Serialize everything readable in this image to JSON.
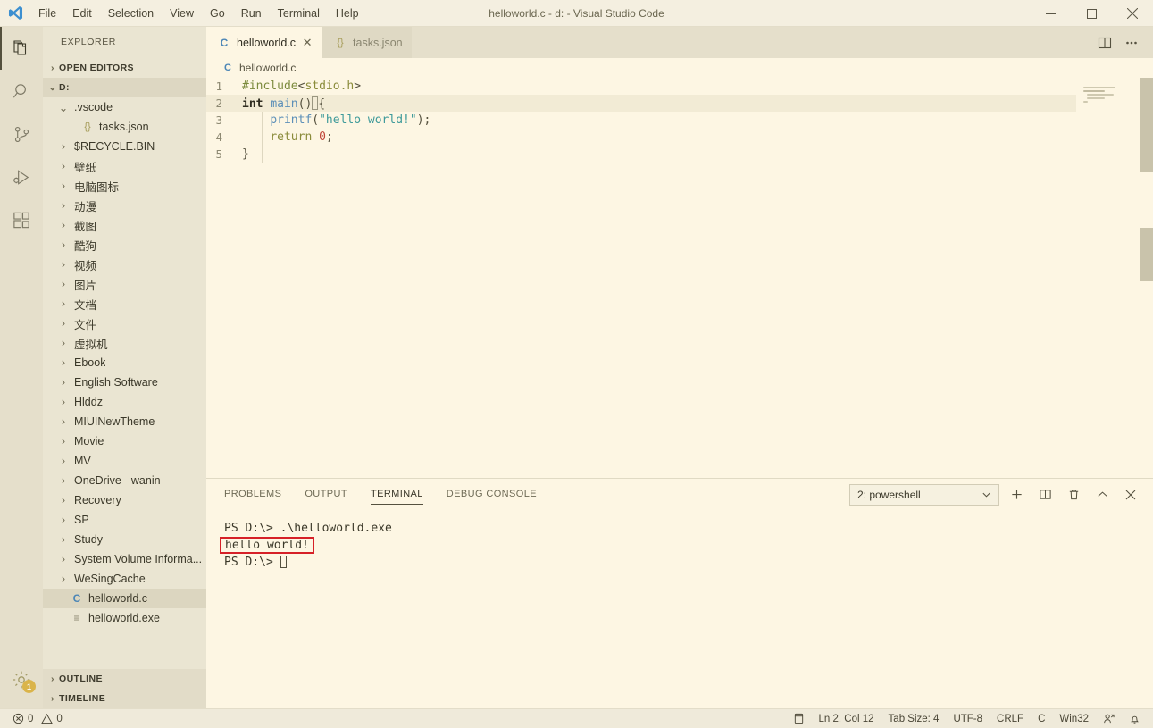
{
  "window": {
    "title": "helloworld.c - d: - Visual Studio Code",
    "logo_icon": "vscode-logo-icon",
    "minimize_label": "—",
    "maximize_label": "□",
    "close_label": "✕"
  },
  "menubar": {
    "items": [
      {
        "label": "File"
      },
      {
        "label": "Edit"
      },
      {
        "label": "Selection"
      },
      {
        "label": "View"
      },
      {
        "label": "Go"
      },
      {
        "label": "Run"
      },
      {
        "label": "Terminal"
      },
      {
        "label": "Help"
      }
    ]
  },
  "activitybar": {
    "items": [
      {
        "name": "explorer-icon",
        "label": "Explorer",
        "active": true
      },
      {
        "name": "search-icon",
        "label": "Search",
        "active": false
      },
      {
        "name": "source-control-icon",
        "label": "Source Control",
        "active": false
      },
      {
        "name": "run-and-debug-icon",
        "label": "Run and Debug",
        "active": false
      },
      {
        "name": "extensions-icon",
        "label": "Extensions",
        "active": false
      }
    ],
    "manage": {
      "name": "gear-icon",
      "label": "Manage",
      "badge": "1"
    }
  },
  "sidebar": {
    "title": "EXPLORER",
    "open_editors_label": "OPEN EDITORS",
    "root_label": "D:",
    "tree": [
      {
        "label": ".vscode",
        "type": "folder",
        "expanded": true,
        "indent": 1
      },
      {
        "label": "tasks.json",
        "type": "json",
        "indent": 2
      },
      {
        "label": "$RECYCLE.BIN",
        "type": "folder",
        "indent": 1
      },
      {
        "label": "壁纸",
        "type": "folder",
        "indent": 1
      },
      {
        "label": "电脑图标",
        "type": "folder",
        "indent": 1
      },
      {
        "label": "动漫",
        "type": "folder",
        "indent": 1
      },
      {
        "label": "截图",
        "type": "folder",
        "indent": 1
      },
      {
        "label": "酷狗",
        "type": "folder",
        "indent": 1
      },
      {
        "label": "视频",
        "type": "folder",
        "indent": 1
      },
      {
        "label": "图片",
        "type": "folder",
        "indent": 1
      },
      {
        "label": "文档",
        "type": "folder",
        "indent": 1
      },
      {
        "label": "文件",
        "type": "folder",
        "indent": 1
      },
      {
        "label": "虚拟机",
        "type": "folder",
        "indent": 1
      },
      {
        "label": "Ebook",
        "type": "folder",
        "indent": 1
      },
      {
        "label": "English Software",
        "type": "folder",
        "indent": 1
      },
      {
        "label": "Hlddz",
        "type": "folder",
        "indent": 1
      },
      {
        "label": "MIUINewTheme",
        "type": "folder",
        "indent": 1
      },
      {
        "label": "Movie",
        "type": "folder",
        "indent": 1
      },
      {
        "label": "MV",
        "type": "folder",
        "indent": 1
      },
      {
        "label": "OneDrive - wanin",
        "type": "folder",
        "indent": 1
      },
      {
        "label": "Recovery",
        "type": "folder",
        "indent": 1
      },
      {
        "label": "SP",
        "type": "folder",
        "indent": 1
      },
      {
        "label": "Study",
        "type": "folder",
        "indent": 1
      },
      {
        "label": "System Volume Informa...",
        "type": "folder",
        "indent": 1
      },
      {
        "label": "WeSingCache",
        "type": "folder",
        "indent": 1
      },
      {
        "label": "helloworld.c",
        "type": "c",
        "indent": 1,
        "selected": true
      },
      {
        "label": "helloworld.exe",
        "type": "exe",
        "indent": 1
      }
    ],
    "bottom_sections": [
      {
        "label": "OUTLINE"
      },
      {
        "label": "TIMELINE"
      }
    ]
  },
  "editor": {
    "tabs": [
      {
        "label": "helloworld.c",
        "icon": "c-file-icon",
        "active": true,
        "closable": true
      },
      {
        "label": "tasks.json",
        "icon": "json-file-icon",
        "active": false,
        "closable": false
      }
    ],
    "tab_actions": [
      {
        "name": "split-editor-icon",
        "label": "Split Editor"
      },
      {
        "name": "more-actions-icon",
        "label": "More Actions..."
      }
    ],
    "breadcrumb": {
      "icon": "c-file-icon",
      "label": "helloworld.c"
    },
    "lines": [
      {
        "num": "1",
        "text": "#include<stdio.h>"
      },
      {
        "num": "2",
        "text": "int main(){",
        "current": true
      },
      {
        "num": "3",
        "text": "    printf(\"hello world!\");"
      },
      {
        "num": "4",
        "text": "    return 0;"
      },
      {
        "num": "5",
        "text": "}"
      }
    ]
  },
  "panel": {
    "tabs": [
      {
        "label": "PROBLEMS",
        "active": false
      },
      {
        "label": "OUTPUT",
        "active": false
      },
      {
        "label": "TERMINAL",
        "active": true
      },
      {
        "label": "DEBUG CONSOLE",
        "active": false
      }
    ],
    "terminal_select": {
      "value": "2: powershell",
      "chevron": "chevron-down-icon"
    },
    "actions": [
      {
        "name": "new-terminal-icon",
        "label": "+"
      },
      {
        "name": "split-terminal-icon",
        "label": "Split Terminal"
      },
      {
        "name": "kill-terminal-icon",
        "label": "Kill Terminal"
      },
      {
        "name": "maximize-panel-icon",
        "label": "Maximize Panel Size"
      },
      {
        "name": "close-panel-icon",
        "label": "Close Panel"
      }
    ],
    "terminal": {
      "prompt1": "PS D:\\> ",
      "command1": ".\\helloworld.exe",
      "output": "hello world!",
      "prompt2": "PS D:\\> ",
      "highlight_color": "#D62027"
    }
  },
  "statusbar": {
    "left": [
      {
        "name": "errors-warnings",
        "icon": "error-icon",
        "errors": "0",
        "warn_icon": "warning-icon",
        "warnings": "0"
      }
    ],
    "right": [
      {
        "name": "layout-icon",
        "label": ""
      },
      {
        "name": "cursor-position",
        "label": "Ln 2, Col 12"
      },
      {
        "name": "indentation",
        "label": "Tab Size: 4"
      },
      {
        "name": "encoding",
        "label": "UTF-8"
      },
      {
        "name": "eol",
        "label": "CRLF"
      },
      {
        "name": "language-mode",
        "label": "C"
      },
      {
        "name": "platform",
        "label": "Win32"
      },
      {
        "name": "remote-icon",
        "label": ""
      },
      {
        "name": "notifications-bell-icon",
        "label": ""
      }
    ]
  },
  "colors": {
    "editor_bg": "#FDF6E3",
    "sidebar_bg": "#EAE5D2",
    "titlebar_bg": "#F4EFE0",
    "accent_red": "#D62027",
    "badge_gold": "#D6A419"
  }
}
